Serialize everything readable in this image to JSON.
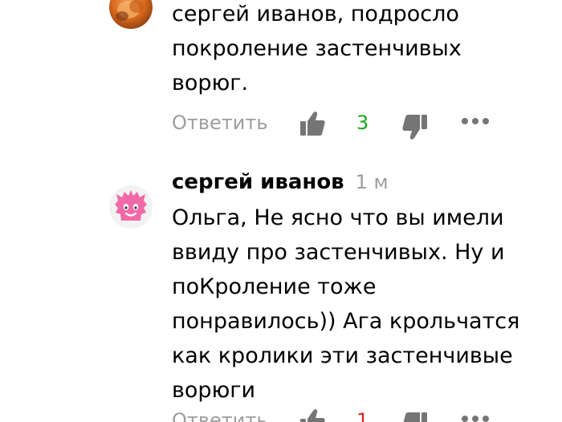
{
  "comments": [
    {
      "text": "сергей иванов, подросло\nпокроление застенчивых\nворюг.",
      "actions": {
        "reply_label": "Ответить",
        "likes": "3",
        "like_icon": "thumbs-up-icon",
        "dislike_icon": "thumbs-down-icon",
        "more_icon": "more-icon"
      },
      "colors": {
        "likes": "#19a71a",
        "muted": "#9e9e9e"
      }
    },
    {
      "author": "сергей иванов",
      "time": "1 м",
      "text": "Ольга, Не ясно что вы имели\nввиду про застенчивых. Ну и\nпоКроление тоже\nпонравилось)) Ага крольчатся\nкак кролики эти застенчивые\nворюги",
      "actions": {
        "reply_label": "Ответить",
        "likes": "1",
        "like_icon": "thumbs-up-icon",
        "dislike_icon": "thumbs-down-icon",
        "more_icon": "more-icon"
      },
      "colors": {
        "likes": "#e02424",
        "avatar_bg": "#f2f2f2",
        "avatar_face": "#f06aa7"
      }
    }
  ]
}
